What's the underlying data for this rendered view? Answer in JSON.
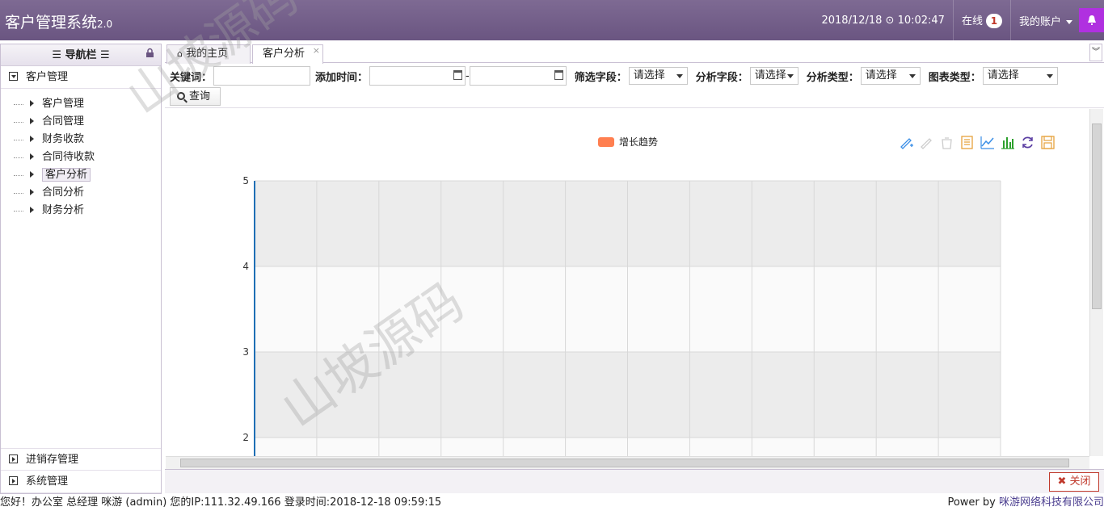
{
  "app": {
    "title": "客户管理系统",
    "version": "2.0"
  },
  "header": {
    "datetime": "2018/12/18 ⊙ 10:02:47",
    "online_label": "在线",
    "online_count": "1",
    "account_label": "我的账户"
  },
  "sidebar": {
    "nav_title": "☰ 导航栏 ☰",
    "section_main": "客户管理",
    "items": [
      {
        "label": "客户管理"
      },
      {
        "label": "合同管理"
      },
      {
        "label": "财务收款"
      },
      {
        "label": "合同待收款"
      },
      {
        "label": "客户分析"
      },
      {
        "label": "合同分析"
      },
      {
        "label": "财务分析"
      }
    ],
    "section_inventory": "进销存管理",
    "section_system": "系统管理"
  },
  "tabs": [
    {
      "label": "我的主页"
    },
    {
      "label": "客户分析"
    }
  ],
  "filters": {
    "keyword_label": "关键词：",
    "addtime_label": "添加时间：",
    "date_sep": "-",
    "filter_field_label": "筛选字段：",
    "filter_field_value": "请选择",
    "analysis_field_label": "分析字段：",
    "analysis_field_value": "请选择",
    "analysis_type_label": "分析类型：",
    "analysis_type_value": "请选择",
    "chart_type_label": "图表类型：",
    "chart_type_value": "请选择",
    "query_label": "查询"
  },
  "chart_data": {
    "type": "bar",
    "series": [
      {
        "name": "增长趋势",
        "values": []
      }
    ],
    "categories": [],
    "yticks": [
      "5",
      "4",
      "3",
      "2"
    ],
    "ylim": [
      2,
      5
    ],
    "legend_position": "top-center",
    "legend_color": "#ff7f50",
    "grid": true
  },
  "toolbox_icons": [
    "mark-icon",
    "mark-undo-icon",
    "mark-clear-icon",
    "data-view-icon",
    "line-chart-icon",
    "bar-chart-icon",
    "restore-icon",
    "save-image-icon"
  ],
  "close_label": "关闭",
  "status": {
    "left": "您好！办公室 总经理 咪游 (admin) 您的IP:111.32.49.166 登录时间:2018-12-18 09:59:15",
    "right_prefix": "Power by ",
    "company": "咪游网络科技有限公司"
  },
  "watermark": "山坡源码"
}
